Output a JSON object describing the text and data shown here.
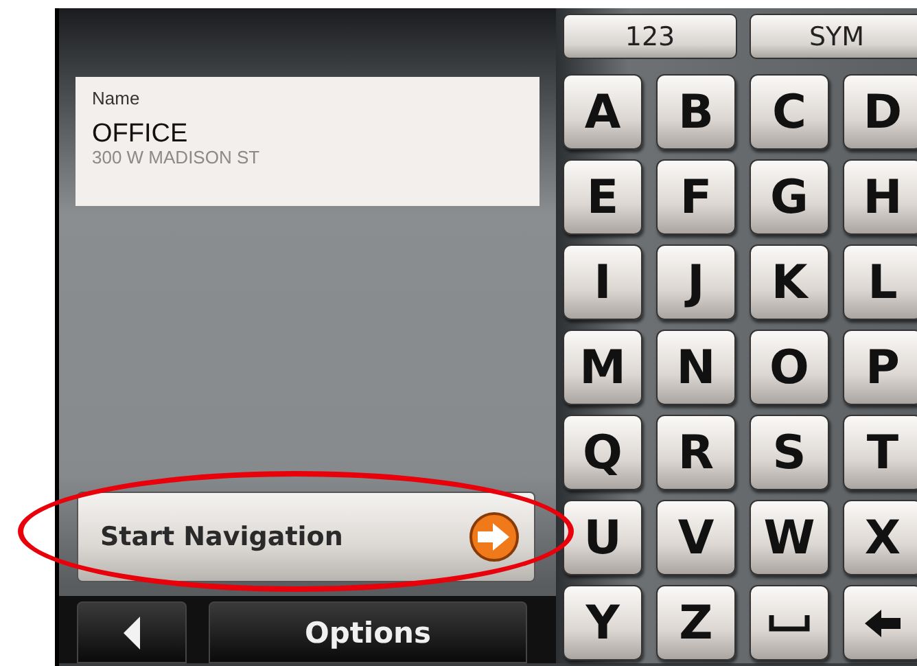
{
  "entry": {
    "label": "Name",
    "name": "OFFICE",
    "address": "300 W MADISON ST"
  },
  "start_button": {
    "label": "Start Navigation"
  },
  "bottom_bar": {
    "options": "Options"
  },
  "mode_keys": [
    "123",
    "SYM"
  ],
  "keys": [
    {
      "kind": "letter",
      "label": "A"
    },
    {
      "kind": "letter",
      "label": "B"
    },
    {
      "kind": "letter",
      "label": "C"
    },
    {
      "kind": "letter",
      "label": "D"
    },
    {
      "kind": "letter",
      "label": "E"
    },
    {
      "kind": "letter",
      "label": "F"
    },
    {
      "kind": "letter",
      "label": "G"
    },
    {
      "kind": "letter",
      "label": "H"
    },
    {
      "kind": "letter",
      "label": "I"
    },
    {
      "kind": "letter",
      "label": "J"
    },
    {
      "kind": "letter",
      "label": "K"
    },
    {
      "kind": "letter",
      "label": "L"
    },
    {
      "kind": "letter",
      "label": "M"
    },
    {
      "kind": "letter",
      "label": "N"
    },
    {
      "kind": "letter",
      "label": "O"
    },
    {
      "kind": "letter",
      "label": "P"
    },
    {
      "kind": "letter",
      "label": "Q"
    },
    {
      "kind": "letter",
      "label": "R"
    },
    {
      "kind": "letter",
      "label": "S"
    },
    {
      "kind": "letter",
      "label": "T"
    },
    {
      "kind": "letter",
      "label": "U"
    },
    {
      "kind": "letter",
      "label": "V"
    },
    {
      "kind": "letter",
      "label": "W"
    },
    {
      "kind": "letter",
      "label": "X"
    },
    {
      "kind": "letter",
      "label": "Y"
    },
    {
      "kind": "letter",
      "label": "Z"
    },
    {
      "kind": "space"
    },
    {
      "kind": "backspace"
    }
  ],
  "annotations": [
    {
      "kind": "ellipse"
    }
  ]
}
